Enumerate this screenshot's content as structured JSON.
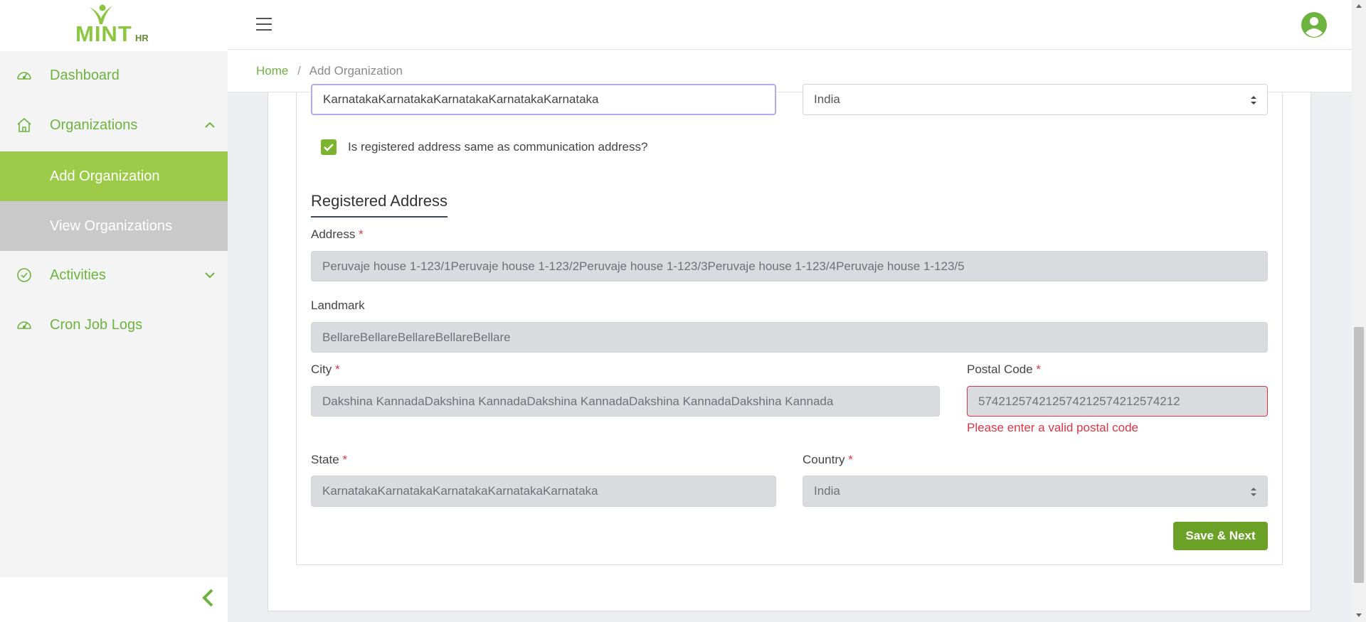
{
  "logo": {
    "text": "MINT",
    "suffix": "HR"
  },
  "sidebar": {
    "items": [
      {
        "label": "Dashboard",
        "icon": "speedometer-icon"
      },
      {
        "label": "Organizations",
        "icon": "home-icon"
      },
      {
        "label": "Add Organization"
      },
      {
        "label": "View Organizations"
      },
      {
        "label": "Activities",
        "icon": "check-circle-icon"
      },
      {
        "label": "Cron Job Logs",
        "icon": "speedometer-icon"
      }
    ]
  },
  "breadcrumb": {
    "home": "Home",
    "separator": "/",
    "current": "Add Organization"
  },
  "communication": {
    "state_value": "KarnatakaKarnatakaKarnatakaKarnatakaKarnataka",
    "country_value": "India"
  },
  "same_address": {
    "label": "Is registered address same as communication address?",
    "checked": true
  },
  "registered": {
    "title": "Registered Address",
    "address_label": "Address",
    "address_value": "Peruvaje house 1-123/1Peruvaje house 1-123/2Peruvaje house 1-123/3Peruvaje house 1-123/4Peruvaje house 1-123/5",
    "landmark_label": "Landmark",
    "landmark_value": "BellareBellareBellareBellareBellare",
    "city_label": "City",
    "city_value": "Dakshina KannadaDakshina KannadaDakshina KannadaDakshina KannadaDakshina Kannada",
    "postal_label": "Postal Code",
    "postal_value": "574212574212574212574212574212",
    "postal_error": "Please enter a valid postal code",
    "state_label": "State",
    "state_value": "KarnatakaKarnatakaKarnatakaKarnatakaKarnataka",
    "country_label": "Country",
    "country_value": "India",
    "required_mark": "*"
  },
  "actions": {
    "save_next": "Save & Next"
  },
  "colors": {
    "brand_green": "#6db33f",
    "active_bg": "#9ccb4a",
    "error": "#dc3545",
    "button": "#6aa126"
  }
}
